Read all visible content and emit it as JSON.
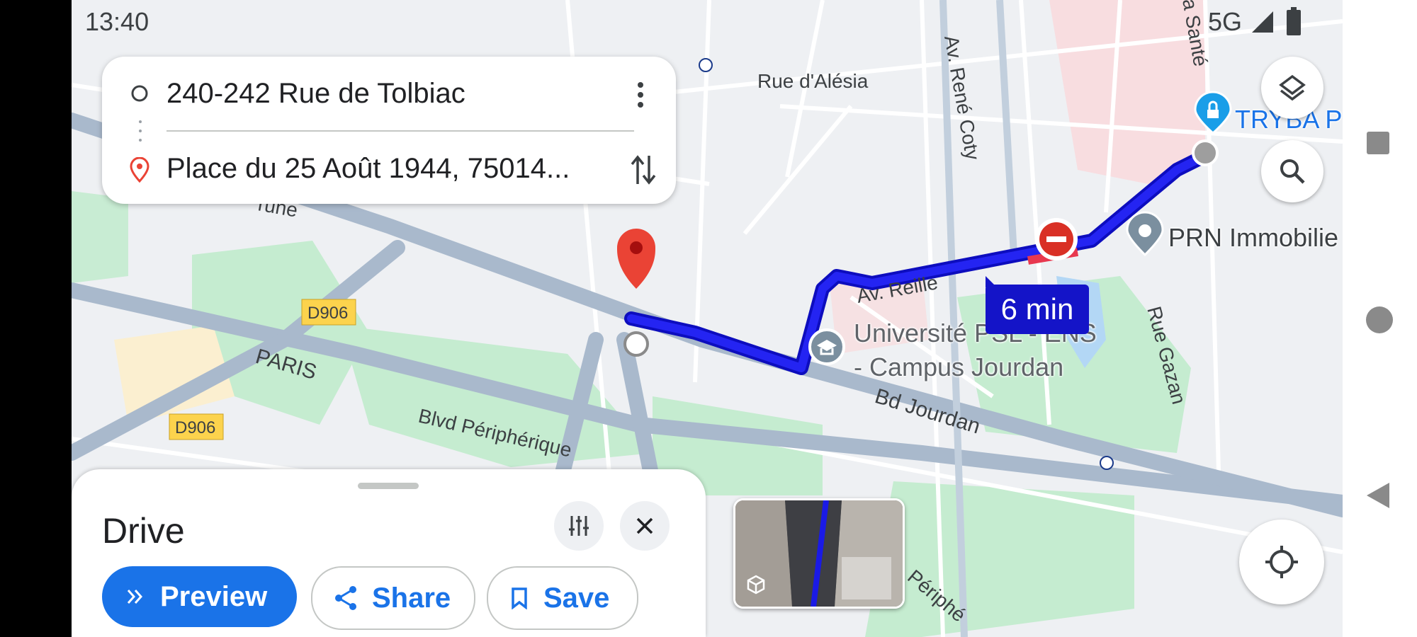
{
  "status_bar": {
    "time": "13:40",
    "network": "5G"
  },
  "route_card": {
    "origin": "240-242 Rue de Tolbiac",
    "destination": "Place du 25 Août 1944, 75014..."
  },
  "map": {
    "streets": {
      "rue_alesia": "Rue d'Alésia",
      "rene_coty": "Av. René Coty",
      "sante": "a Santé",
      "reille": "Av. Reille",
      "gazan": "Rue Gazan",
      "jourdan": "Bd Jourdan",
      "paris": "PARIS",
      "peripherique": "Blvd Périphérique",
      "peripherique2": "Périphé",
      "rune": "rune",
      "d906_a": "D906",
      "d906_b": "D906"
    },
    "places": {
      "tryba": "TRYBA P",
      "prn": "PRN Immobilie",
      "universite_line1": "Université PSL - ENS",
      "universite_line2": "- Campus Jourdan"
    },
    "route_time": "6 min",
    "colors": {
      "route": "#1a1ae6",
      "park": "#c5ecd0",
      "highway": "#a9b9cc",
      "accent": "#1a73e8",
      "pin": "#ea4335"
    }
  },
  "bottom_sheet": {
    "mode": "Drive",
    "preview_label": "Preview",
    "share_label": "Share",
    "save_label": "Save"
  }
}
